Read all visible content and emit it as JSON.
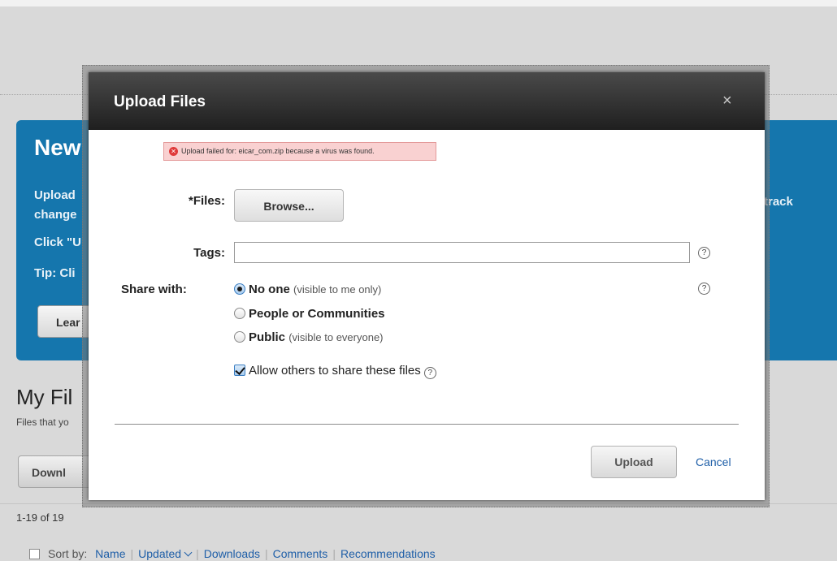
{
  "background": {
    "hero_title": "New",
    "hero_lines": [
      "Upload",
      "change",
      "Click \"U",
      "Tip: Cli"
    ],
    "hero_right_text": "track",
    "hero_button": "Lear",
    "section_title": "My Fil",
    "section_desc": "Files that yo",
    "download_button": "Downl",
    "count": "1-19 of 19",
    "sort": {
      "label": "Sort by:",
      "options": [
        "Name",
        "Updated",
        "Downloads",
        "Comments",
        "Recommendations"
      ]
    }
  },
  "dialog": {
    "title": "Upload Files",
    "close_symbol": "×",
    "error": "Upload failed for: eicar_com.zip because a virus was found.",
    "files_label": "*Files:",
    "browse_button": "Browse...",
    "tags_label": "Tags:",
    "tags_value": "",
    "share_label": "Share with:",
    "share_options": [
      {
        "label": "No one",
        "note": "(visible to me only)",
        "selected": true
      },
      {
        "label": "People or Communities",
        "note": "",
        "selected": false
      },
      {
        "label": "Public",
        "note": "(visible to everyone)",
        "selected": false
      }
    ],
    "allow_share_label": "Allow others to share these files",
    "allow_share_checked": true,
    "help_symbol": "?",
    "upload_button": "Upload",
    "cancel_link": "Cancel"
  },
  "colors": {
    "hero_blue": "#1576ad",
    "link_blue": "#1f5fa8",
    "error_bg": "#f9d1d1",
    "header_dark": "#2b2b2b"
  }
}
